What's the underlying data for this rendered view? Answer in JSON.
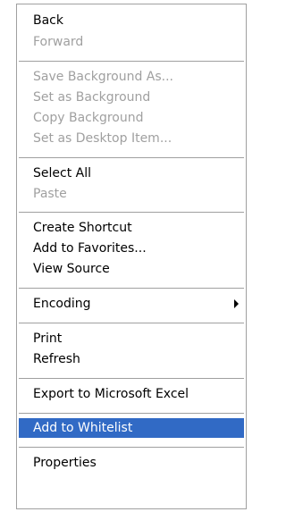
{
  "context_menu": {
    "items": [
      {
        "label": "Back",
        "enabled": true
      },
      {
        "label": "Forward",
        "enabled": false
      },
      {
        "label": "Save Background As...",
        "enabled": false
      },
      {
        "label": "Set as Background",
        "enabled": false
      },
      {
        "label": "Copy Background",
        "enabled": false
      },
      {
        "label": "Set as Desktop Item...",
        "enabled": false
      },
      {
        "label": "Select All",
        "enabled": true
      },
      {
        "label": "Paste",
        "enabled": false
      },
      {
        "label": "Create Shortcut",
        "enabled": true
      },
      {
        "label": "Add to Favorites...",
        "enabled": true
      },
      {
        "label": "View Source",
        "enabled": true
      },
      {
        "label": "Encoding",
        "enabled": true,
        "has_submenu": true
      },
      {
        "label": "Print",
        "enabled": true
      },
      {
        "label": "Refresh",
        "enabled": true
      },
      {
        "label": "Export to Microsoft Excel",
        "enabled": true
      },
      {
        "label": "Add to Whitelist",
        "enabled": true,
        "highlighted": true
      },
      {
        "label": "Properties",
        "enabled": true
      }
    ]
  },
  "colors": {
    "highlight": "#316ac5",
    "disabled_text": "#a0a0a0",
    "separator": "#a0a0a0"
  }
}
